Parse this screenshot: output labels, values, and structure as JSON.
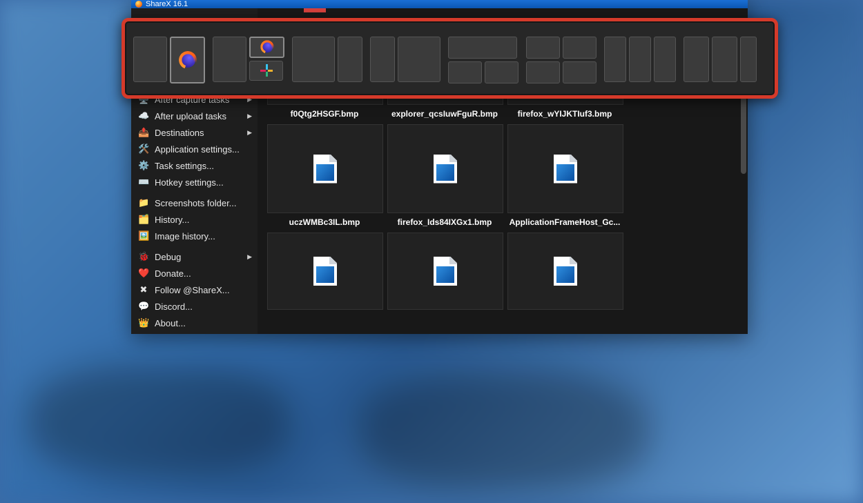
{
  "window": {
    "title": "ShareX 16.1"
  },
  "layout_popup": {
    "highlight_color": "#d53a2a",
    "groups": [
      "two-side",
      "one-plus-two",
      "wide-narrow",
      "two-by-two",
      "mixed-grid",
      "three-col",
      "three-col-narrow-last"
    ],
    "selected_app_slot": "firefox"
  },
  "sidebar": {
    "items": [
      {
        "icon": "🖥️",
        "label": "After capture tasks",
        "submenu": true
      },
      {
        "icon": "☁️",
        "label": "After upload tasks",
        "submenu": true
      },
      {
        "icon": "📤",
        "label": "Destinations",
        "submenu": true
      },
      {
        "icon": "🛠️",
        "label": "Application settings...",
        "submenu": false
      },
      {
        "icon": "⚙️",
        "label": "Task settings...",
        "submenu": false
      },
      {
        "icon": "⌨️",
        "label": "Hotkey settings...",
        "submenu": false
      },
      {
        "gap": true
      },
      {
        "icon": "📁",
        "label": "Screenshots folder...",
        "submenu": false
      },
      {
        "icon": "🗂️",
        "label": "History...",
        "submenu": false
      },
      {
        "icon": "🖼️",
        "label": "Image history...",
        "submenu": false
      },
      {
        "gap": true
      },
      {
        "icon": "🐞",
        "label": "Debug",
        "submenu": true
      },
      {
        "icon": "❤️",
        "label": "Donate...",
        "submenu": false
      },
      {
        "icon": "✖",
        "label": "Follow @ShareX...",
        "submenu": false
      },
      {
        "icon": "💬",
        "label": "Discord...",
        "submenu": false
      },
      {
        "icon": "👑",
        "label": "About...",
        "submenu": false
      }
    ]
  },
  "gallery": {
    "row_top": [
      {
        "name": "f0Qtg2HSGF.bmp"
      },
      {
        "name": "explorer_qcsIuwFguR.bmp"
      },
      {
        "name": "firefox_wYIJKTIuf3.bmp"
      }
    ],
    "row_mid": [
      {
        "name": "uczWMBc3IL.bmp"
      },
      {
        "name": "firefox_Ids84IXGx1.bmp"
      },
      {
        "name": "ApplicationFrameHost_Gc..."
      }
    ],
    "row_bot": [
      {
        "name": ""
      },
      {
        "name": ""
      },
      {
        "name": ""
      }
    ]
  }
}
